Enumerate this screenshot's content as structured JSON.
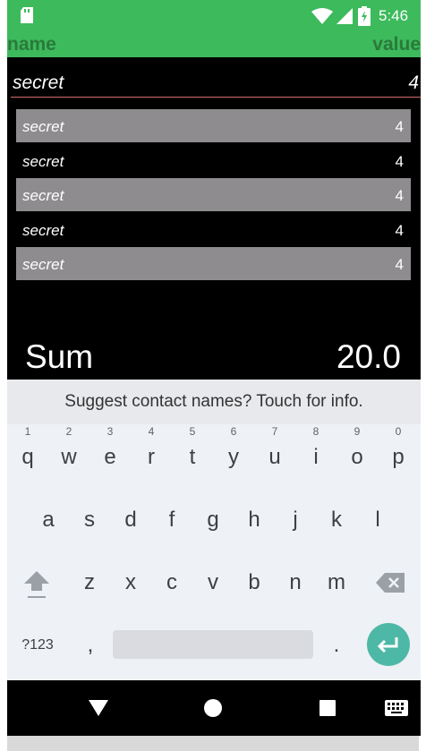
{
  "status_bar": {
    "time": "5:46",
    "icons": [
      "sd-card-icon",
      "wifi-icon",
      "signal-icon",
      "battery-charging-icon"
    ]
  },
  "header": {
    "name_label": "name",
    "value_label": "value"
  },
  "editor": {
    "name_value": "secret",
    "value_value": "4"
  },
  "list": {
    "items": [
      {
        "name": "secret",
        "value": "4",
        "shaded": true
      },
      {
        "name": "secret",
        "value": "4",
        "shaded": false
      },
      {
        "name": "secret",
        "value": "4",
        "shaded": true
      },
      {
        "name": "secret",
        "value": "4",
        "shaded": false
      },
      {
        "name": "secret",
        "value": "4",
        "shaded": true
      }
    ]
  },
  "sum": {
    "label": "Sum",
    "value": "20.0"
  },
  "keyboard": {
    "suggestion": "Suggest contact names? Touch for info.",
    "row1": [
      {
        "key": "q",
        "hint": "1"
      },
      {
        "key": "w",
        "hint": "2"
      },
      {
        "key": "e",
        "hint": "3"
      },
      {
        "key": "r",
        "hint": "4"
      },
      {
        "key": "t",
        "hint": "5"
      },
      {
        "key": "y",
        "hint": "6"
      },
      {
        "key": "u",
        "hint": "7"
      },
      {
        "key": "i",
        "hint": "8"
      },
      {
        "key": "o",
        "hint": "9"
      },
      {
        "key": "p",
        "hint": "0"
      }
    ],
    "row2": [
      "a",
      "s",
      "d",
      "f",
      "g",
      "h",
      "j",
      "k",
      "l"
    ],
    "row3": [
      "z",
      "x",
      "c",
      "v",
      "b",
      "n",
      "m"
    ],
    "symbols_label": "?123",
    "comma_label": ",",
    "period_label": ".",
    "accent_color": "#4eb8a6"
  },
  "nav": {
    "icons": [
      "back-icon",
      "home-icon",
      "recents-icon",
      "keyboard-switch-icon"
    ]
  },
  "colors": {
    "accent": "#3dba5c",
    "list_shade": "#8e8c8f"
  }
}
